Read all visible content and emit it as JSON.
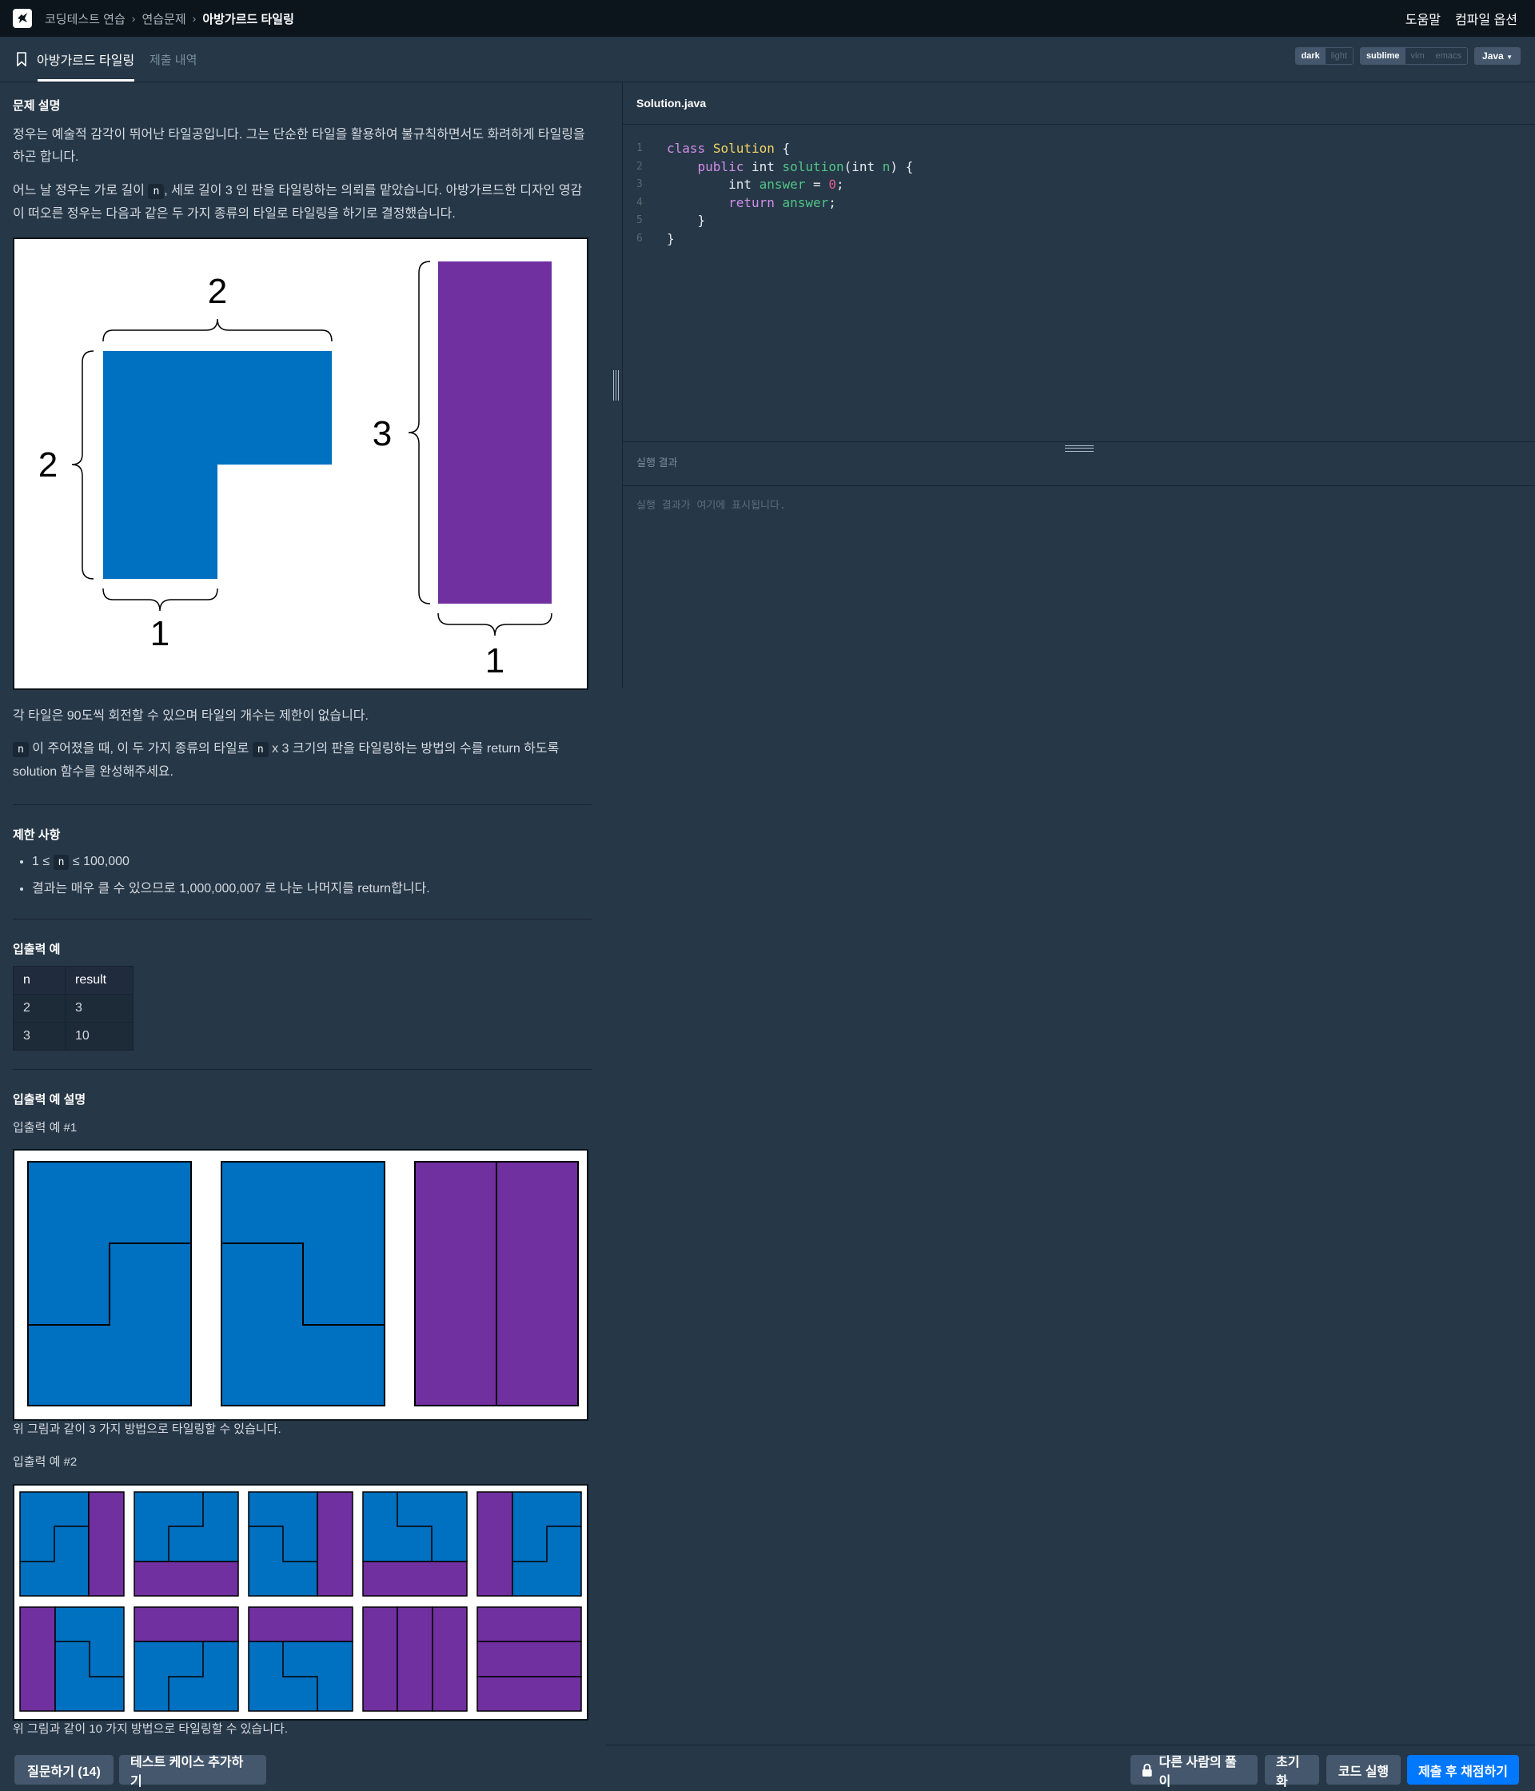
{
  "topbar": {
    "breadcrumb": [
      "코딩테스트 연습",
      "연습문제",
      "아방가르드 타일링"
    ],
    "help": "도움말",
    "compile_options": "컴파일 옵션"
  },
  "tabs": {
    "active": "아방가르드 타일링",
    "submissions": "제출 내역"
  },
  "options": {
    "themes": [
      "dark",
      "light"
    ],
    "keymaps": [
      "sublime",
      "vim",
      "emacs"
    ],
    "language": "Java"
  },
  "problem": {
    "title_desc": "문제 설명",
    "p1": "정우는 예술적 감각이 뛰어난 타일공입니다. 그는 단순한 타일을 활용하여 불규칙하면서도 화려하게 타일링을 하곤 합니다.",
    "p2a": "어느 날 정우는 가로 길이",
    "p2b": ", 세로 길이 3 인 판을 타일링하는 의뢰를 맡았습니다. 아방가르드한 디자인 영감이 떠오른 정우는 다음과 같은 두 가지 종류의 타일로 타일링을 하기로 결정했습니다.",
    "fig1_labels": {
      "l_top": "2",
      "l_left": "2",
      "l_bottom": "1",
      "bar_left": "3",
      "bar_bottom": "1"
    },
    "p3": "각 타일은 90도씩 회전할 수 있으며 타일의 개수는 제한이 없습니다.",
    "p4a": "이 주어졌을 때, 이 두 가지 종류의 타일로",
    "p4b": "x 3 크기의 판을 타일링하는 방법의 수를 return 하도록 solution 함수를 완성해주세요.",
    "var_n": "n",
    "title_limits": "제한 사항",
    "limit1a": "1 ≤",
    "limit1b": "≤ 100,000",
    "limit2": "결과는 매우 클 수 있으므로 1,000,000,007 로 나눈 나머지를 return합니다.",
    "title_io": "입출력 예",
    "io_headers": [
      "n",
      "result"
    ],
    "io_rows": [
      [
        "2",
        "3"
      ],
      [
        "3",
        "10"
      ]
    ],
    "title_io_desc": "입출력 예 설명",
    "ex1_title": "입출력 예 #1",
    "ex1_caption": "위 그림과 같이 3 가지 방법으로 타일링할 수 있습니다.",
    "ex2_title": "입출력 예 #2",
    "ex2_caption": "위 그림과 같이 10 가지 방법으로 타일링할 수 있습니다."
  },
  "editor": {
    "filename": "Solution.java",
    "line_numbers": [
      "1",
      "2",
      "3",
      "4",
      "5",
      "6"
    ],
    "tokens": {
      "class": "class",
      "Solution": "Solution",
      "brace_open": " {",
      "public": "public",
      "int": "int",
      "solution": "solution",
      "paren": "(",
      "n": "n",
      "paren_close": ") {",
      "answer": "answer",
      "eq": " = ",
      "zero": "0",
      "semi": ";",
      "return": "return",
      "close": "}"
    }
  },
  "result": {
    "title": "실행 결과",
    "placeholder": "실행 결과가 여기에 표시됩니다."
  },
  "footer": {
    "ask": "질문하기 (14)",
    "add_testcase": "테스트 케이스 추가하기",
    "others": "다른 사람의 풀이",
    "reset": "초기화",
    "run": "코드 실행",
    "submit": "제출 후 채점하기"
  },
  "colors": {
    "tile_blue": "#0070c0",
    "tile_purple": "#7030a0",
    "accent": "#0078ff"
  }
}
